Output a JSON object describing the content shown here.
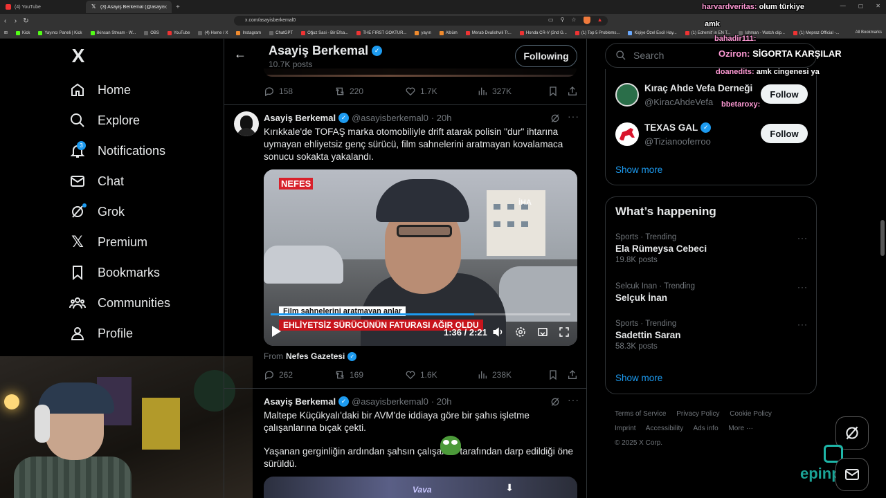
{
  "browser": {
    "tabs": [
      {
        "title": "(4) YouTube",
        "active": false
      },
      {
        "title": "(3) Asayiş Berkemal (@asayisbe...",
        "active": true
      }
    ],
    "new_tab": "+",
    "url": "x.com/asayisberkemal0",
    "bookmarks": [
      "Kick",
      "Yayıncı Paneli | Kick",
      "ilkinsan Stream - W...",
      "OBS",
      "YouTube",
      "(4) Home / X",
      "Instagram",
      "ChatGPT",
      "Oğuz Sasi - Bir Efsa...",
      "THE FIRST GOKTUR...",
      "yayın",
      "Albüm",
      "Merab Dvalishvili Tr...",
      "Honda CR-V (2nd G...",
      "(1) Top 5 Problems...",
      "Kişiye Özel Excil Hay...",
      "(1) Edremit' in EN T...",
      "Ishman - Watch clip...",
      "(1) Mepraz Official -..."
    ],
    "all_bookmarks": "All Bookmarks"
  },
  "nav": {
    "logo": "X",
    "notifications_badge": "3",
    "items": [
      "Home",
      "Explore",
      "Notifications",
      "Chat",
      "Grok",
      "Premium",
      "Bookmarks",
      "Communities",
      "Profile"
    ]
  },
  "header": {
    "name": "Asayiş Berkemal",
    "posts": "10.7K posts",
    "following_label": "Following"
  },
  "prev_actions": {
    "replies": "158",
    "reposts": "220",
    "likes": "1.7K",
    "views": "327K"
  },
  "tweet1": {
    "name": "Asayiş Berkemal",
    "handle": "@asayisberkemal0",
    "time": "· 20h",
    "text": "Kırıkkale'de TOFAŞ marka otomobiliyle drift atarak polisin \"dur\" ihtarına uymayan ehliyetsiz genç sürücü, film sahnelerini aratmayan kovalamaca sonucu sokakta yakalandı.",
    "video": {
      "brand": "NEFES",
      "agency": "İHA",
      "caption_top": "Film sahnelerini aratmayan anlar",
      "caption_bottom": "EHLİYETSİZ SÜRÜCÜNÜN FATURASI AĞIR OLDU",
      "time": "1:36 / 2:21",
      "progress": 0.68
    },
    "from_label": "From",
    "from_name": "Nefes Gazetesi",
    "replies": "262",
    "reposts": "169",
    "likes": "1.6K",
    "views": "238K"
  },
  "tweet2": {
    "name": "Asayiş Berkemal",
    "handle": "@asayisberkemal0",
    "time": "· 20h",
    "text1": "Maltepe Küçükyalı'daki bir AVM'de iddiaya göre bir şahıs işletme çalışanlarına bıçak çekti.",
    "text2": "Yaşanan gerginliğin ardından şahsın çalışanlar tarafından darp edildiği öne sürüldü.",
    "thumb_text": "Vava"
  },
  "right": {
    "search_placeholder": "Search",
    "who_to_follow": [
      {
        "name": "Kıraç Ahde Vefa Derneği",
        "handle": "@KiracAhdeVefa",
        "button": "Follow",
        "color": "#2a6e49"
      },
      {
        "name": "TEXAS GAL",
        "handle": "@Tizianooferroo",
        "button": "Follow",
        "color": "#d9142b"
      }
    ],
    "show_more": "Show more",
    "trends_title": "What’s happening",
    "trends": [
      {
        "meta": "Sports · Trending",
        "name": "Ela Rümeysa Cebeci",
        "count": "19.8K posts"
      },
      {
        "meta": "Selcuk Inan · Trending",
        "name": "Selçuk İnan",
        "count": ""
      },
      {
        "meta": "Sports · Trending",
        "name": "Sadettin Saran",
        "count": "58.3K posts"
      }
    ],
    "trends_show_more": "Show more",
    "footer": [
      "Terms of Service",
      "Privacy Policy",
      "Cookie Policy",
      "Imprint",
      "Accessibility",
      "Ads info",
      "More ···",
      "© 2025 X Corp."
    ]
  },
  "chat_overlay": [
    {
      "user": "harvardveritas:",
      "msg": "olum türkiye"
    },
    {
      "user": "",
      "msg": "amk"
    },
    {
      "user": "bahadir111:",
      "msg": ""
    },
    {
      "user": "Oziron:",
      "msg": "SİGORTA KARŞILAR"
    },
    {
      "user": "doanedits:",
      "msg": "amk cingenesi ya"
    },
    {
      "user": "bbetaroxy:",
      "msg": ""
    }
  ],
  "watermark": "epinpay",
  "colors": {
    "accent": "#1d9bf0",
    "background": "#000000",
    "border": "#2f3336",
    "muted": "#71767b",
    "text": "#e7e9ea"
  }
}
